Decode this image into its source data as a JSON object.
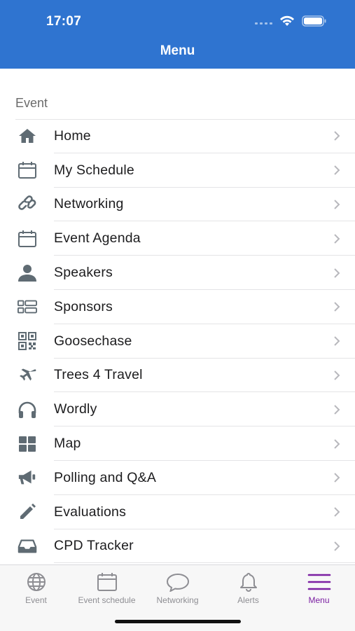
{
  "status": {
    "time": "17:07"
  },
  "header": {
    "title": "Menu"
  },
  "section": {
    "title": "Event"
  },
  "menu": {
    "items": [
      {
        "label": "Home",
        "icon": "home-icon"
      },
      {
        "label": "My Schedule",
        "icon": "calendar-icon"
      },
      {
        "label": "Networking",
        "icon": "link-icon"
      },
      {
        "label": "Event Agenda",
        "icon": "calendar-icon"
      },
      {
        "label": "Speakers",
        "icon": "person-icon"
      },
      {
        "label": "Sponsors",
        "icon": "list-icon"
      },
      {
        "label": "Goosechase",
        "icon": "qr-code-icon"
      },
      {
        "label": "Trees 4 Travel",
        "icon": "airplane-icon"
      },
      {
        "label": "Wordly",
        "icon": "headphones-icon"
      },
      {
        "label": "Map",
        "icon": "grid-icon"
      },
      {
        "label": "Polling and Q&A",
        "icon": "megaphone-icon"
      },
      {
        "label": "Evaluations",
        "icon": "pencil-icon"
      },
      {
        "label": "CPD Tracker",
        "icon": "inbox-tray-icon"
      }
    ]
  },
  "tabbar": {
    "tabs": [
      {
        "label": "Event",
        "icon": "globe-icon"
      },
      {
        "label": "Event schedule",
        "icon": "calendar-icon"
      },
      {
        "label": "Networking",
        "icon": "chat-bubble-icon"
      },
      {
        "label": "Alerts",
        "icon": "bell-icon"
      },
      {
        "label": "Menu",
        "icon": "hamburger-menu-icon",
        "active": true
      }
    ]
  },
  "colors": {
    "header": "#2f74d0",
    "icon": "#5f6b73",
    "active_tab": "#7b1fa2",
    "inactive_tab": "#8e8e93"
  }
}
